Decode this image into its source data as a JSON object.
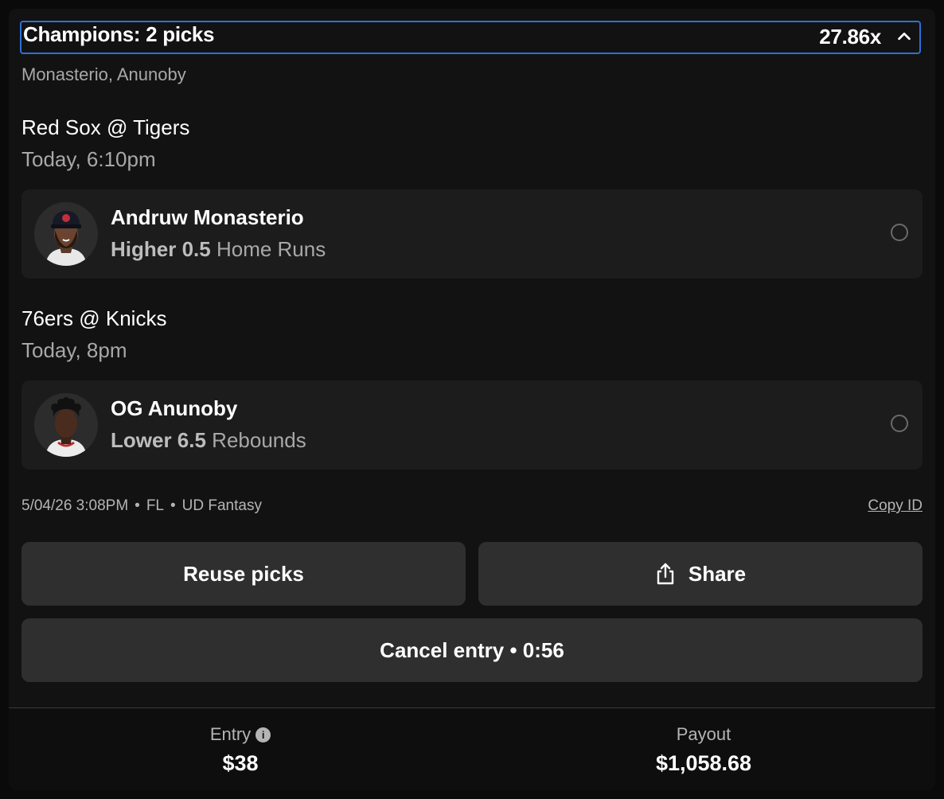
{
  "header": {
    "title": "Champions: 2 picks",
    "multiplier": "27.86x",
    "players_summary": "Monasterio, Anunoby"
  },
  "games": [
    {
      "matchup": "Red Sox @ Tigers",
      "time": "Today, 6:10pm",
      "pick": {
        "player": "Andruw Monasterio",
        "direction_line": "Higher 0.5",
        "stat": "Home Runs",
        "avatar_icon": "player-headshot-icon"
      }
    },
    {
      "matchup": "76ers @ Knicks",
      "time": "Today, 8pm",
      "pick": {
        "player": "OG Anunoby",
        "direction_line": "Lower 6.5",
        "stat": "Rebounds",
        "avatar_icon": "player-headshot-icon"
      }
    }
  ],
  "meta": {
    "datetime": "5/04/26 3:08PM",
    "state": "FL",
    "platform": "UD Fantasy",
    "copy_id": "Copy ID"
  },
  "buttons": {
    "reuse": "Reuse picks",
    "share": "Share",
    "cancel": "Cancel entry • 0:56"
  },
  "footer": {
    "entry_label": "Entry",
    "entry_value": "$38",
    "payout_label": "Payout",
    "payout_value": "$1,058.68"
  },
  "colors": {
    "background": "#121212",
    "card": "#1c1c1c",
    "button": "#2f2f2f",
    "focus_border": "#2f6fd6"
  }
}
